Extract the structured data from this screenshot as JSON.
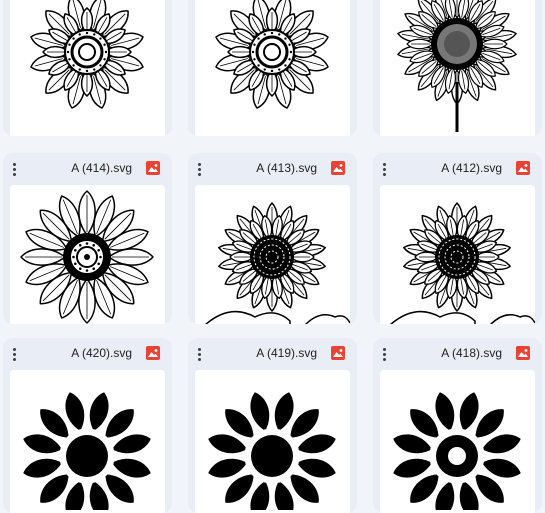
{
  "colors": {
    "background": "#f1f4f9",
    "card": "#e9eef6",
    "file_icon": "#ea4335"
  },
  "files": [
    {
      "name": "",
      "icon": "image-icon",
      "style": "mandala-outline"
    },
    {
      "name": "",
      "icon": "image-icon",
      "style": "mandala-outline"
    },
    {
      "name": "",
      "icon": "image-icon",
      "style": "sunflower-dotted"
    },
    {
      "name": "A (414).svg",
      "icon": "image-icon",
      "style": "sunflower-line"
    },
    {
      "name": "A (413).svg",
      "icon": "image-icon",
      "style": "sunflower-checked"
    },
    {
      "name": "A (412).svg",
      "icon": "image-icon",
      "style": "sunflower-checked"
    },
    {
      "name": "A (420).svg",
      "icon": "image-icon",
      "style": "silhouette-solid"
    },
    {
      "name": "A (419).svg",
      "icon": "image-icon",
      "style": "silhouette-solid"
    },
    {
      "name": "A (418).svg",
      "icon": "image-icon",
      "style": "silhouette-ring"
    }
  ]
}
